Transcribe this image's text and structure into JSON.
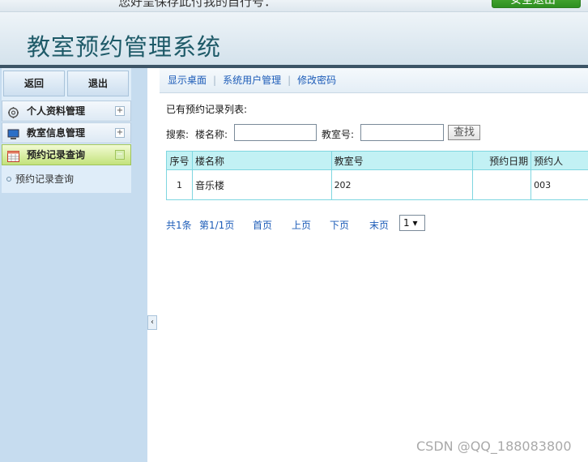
{
  "app": {
    "title": "教室预约管理系统",
    "welcome_text": "您好呈保存此付我的自行号：",
    "safe_exit_label": "安全退出"
  },
  "sidebar": {
    "back_label": "返回",
    "logout_label": "退出",
    "menus": [
      {
        "label": "个人资料管理",
        "icon": "gear-icon",
        "toggle": "+"
      },
      {
        "label": "教室信息管理",
        "icon": "monitor-icon",
        "toggle": "+"
      },
      {
        "label": "预约记录查询",
        "icon": "table-icon",
        "toggle": "−",
        "active": true
      }
    ],
    "sub_items": [
      "预约记录查询"
    ],
    "collapse_glyph": "‹"
  },
  "nav": {
    "links": [
      "显示桌面",
      "系统用户管理",
      "修改密码"
    ],
    "separator": "|"
  },
  "list": {
    "caption": "已有预约记录列表:",
    "search_label": "搜索:",
    "building_label": "楼名称:",
    "room_label": "教室号:",
    "building_value": "",
    "room_value": "",
    "find_label": "查找"
  },
  "table": {
    "headers": [
      "序号",
      "楼名称",
      "教室号",
      "预约日期",
      "预约人"
    ],
    "rows": [
      {
        "no": "1",
        "building": "音乐楼",
        "room": "202",
        "date": "",
        "person": "003"
      }
    ]
  },
  "pager": {
    "total": "共1条",
    "page": "第1/1页",
    "first": "首页",
    "prev": "上页",
    "next": "下页",
    "last": "末页",
    "selected": "1 ▾"
  },
  "watermark": "CSDN @QQ_188083800",
  "colors": {
    "title": "#1e5a68",
    "link": "#1d5cb8",
    "table_header_bg": "#c2f1f4",
    "table_border": "#7fd6e0",
    "active_menu": "#c3e27c"
  }
}
